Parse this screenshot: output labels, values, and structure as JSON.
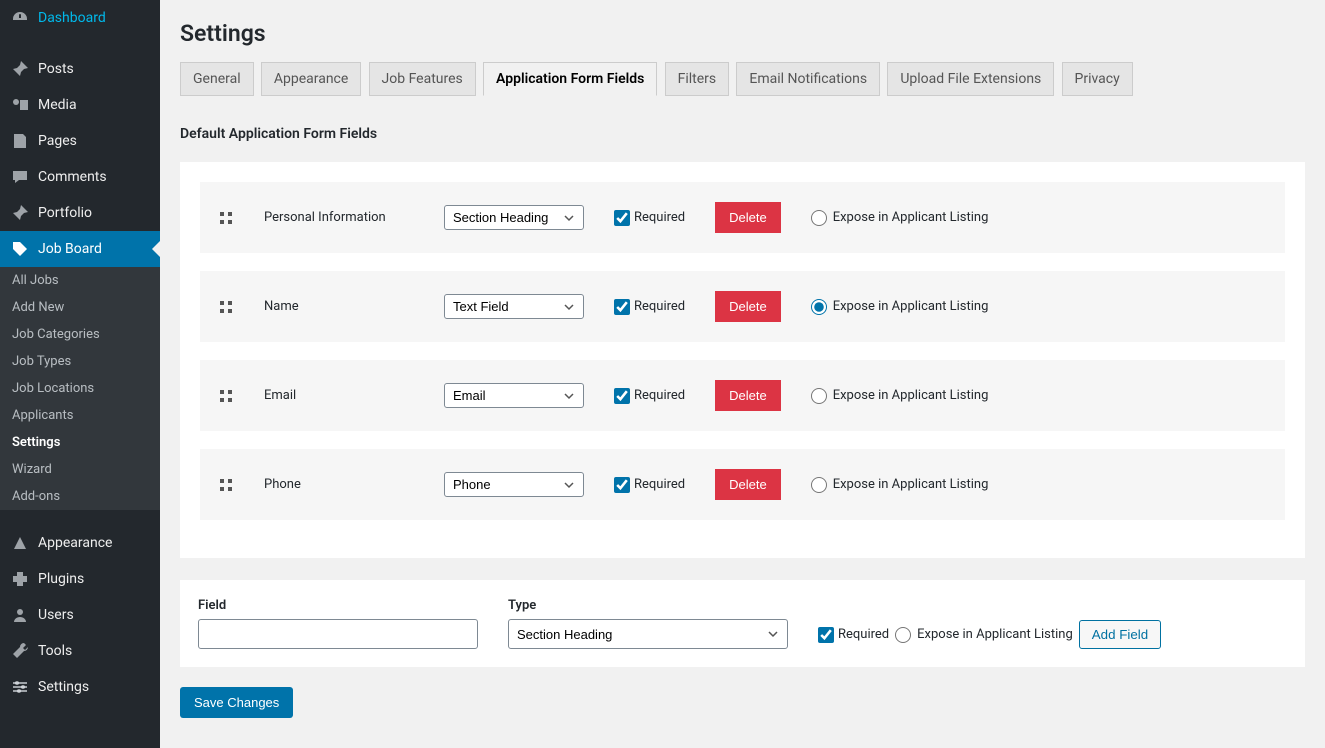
{
  "sidebar": {
    "items": [
      {
        "label": "Dashboard",
        "icon": "dashboard"
      },
      {
        "label": "Posts",
        "icon": "pin"
      },
      {
        "label": "Media",
        "icon": "media"
      },
      {
        "label": "Pages",
        "icon": "pages"
      },
      {
        "label": "Comments",
        "icon": "comments"
      },
      {
        "label": "Portfolio",
        "icon": "pin"
      },
      {
        "label": "Job Board",
        "icon": "job",
        "active": true
      },
      {
        "label": "Appearance",
        "icon": "appearance"
      },
      {
        "label": "Plugins",
        "icon": "plugins"
      },
      {
        "label": "Users",
        "icon": "users"
      },
      {
        "label": "Tools",
        "icon": "tools"
      },
      {
        "label": "Settings",
        "icon": "settings"
      }
    ],
    "submenu": [
      "All Jobs",
      "Add New",
      "Job Categories",
      "Job Types",
      "Job Locations",
      "Applicants",
      "Settings",
      "Wizard",
      "Add-ons"
    ],
    "submenu_current": "Settings"
  },
  "page": {
    "title": "Settings",
    "tabs": [
      "General",
      "Appearance",
      "Job Features",
      "Application Form Fields",
      "Filters",
      "Email Notifications",
      "Upload File Extensions",
      "Privacy"
    ],
    "active_tab": "Application Form Fields",
    "section_title": "Default Application Form Fields"
  },
  "labels": {
    "required": "Required",
    "expose": "Expose in Applicant Listing",
    "delete": "Delete",
    "field": "Field",
    "type": "Type",
    "add_field": "Add Field",
    "save": "Save Changes"
  },
  "fields": [
    {
      "name": "Personal Information",
      "type": "Section Heading",
      "required": true,
      "expose": false
    },
    {
      "name": "Name",
      "type": "Text Field",
      "required": true,
      "expose": true
    },
    {
      "name": "Email",
      "type": "Email",
      "required": true,
      "expose": false
    },
    {
      "name": "Phone",
      "type": "Phone",
      "required": true,
      "expose": false
    }
  ],
  "add": {
    "field_value": "",
    "type_value": "Section Heading",
    "required": true,
    "expose": false
  }
}
